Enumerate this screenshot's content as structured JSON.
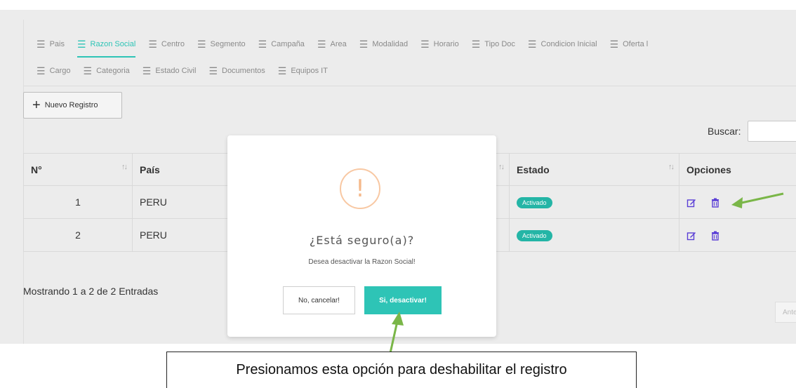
{
  "tabs_row1": [
    {
      "label": "Pais",
      "active": false
    },
    {
      "label": "Razon Social",
      "active": true
    },
    {
      "label": "Centro",
      "active": false
    },
    {
      "label": "Segmento",
      "active": false
    },
    {
      "label": "Campaña",
      "active": false
    },
    {
      "label": "Area",
      "active": false
    },
    {
      "label": "Modalidad",
      "active": false
    },
    {
      "label": "Horario",
      "active": false
    },
    {
      "label": "Tipo Doc",
      "active": false
    },
    {
      "label": "Condicion Inicial",
      "active": false
    },
    {
      "label": "Oferta l",
      "active": false
    }
  ],
  "tabs_row2": [
    {
      "label": "Cargo"
    },
    {
      "label": "Categoria"
    },
    {
      "label": "Estado Civil"
    },
    {
      "label": "Documentos"
    },
    {
      "label": "Equipos IT"
    }
  ],
  "toolbar": {
    "new_label": "Nuevo Registro"
  },
  "search": {
    "label": "Buscar:",
    "value": ""
  },
  "table": {
    "headers": {
      "num": "N°",
      "country": "País",
      "status": "Estado",
      "options": "Opciones"
    },
    "rows": [
      {
        "num": "1",
        "country": "PERU",
        "status": "Activado"
      },
      {
        "num": "2",
        "country": "PERU",
        "status": "Activado"
      }
    ]
  },
  "footer": {
    "showing": "Mostrando 1 a 2 de 2 Entradas",
    "prev": "Ante"
  },
  "modal": {
    "icon": "!",
    "title": "¿Está seguro(a)?",
    "text": "Desea desactivar la Razon Social!",
    "cancel": "No, cancelar!",
    "confirm": "Si, desactivar!"
  },
  "caption": "Presionamos esta opción para deshabilitar el registro",
  "colors": {
    "accent": "#2ec4b6",
    "badge": "#24b5a6",
    "warning": "#f5b98b",
    "icon": "#5b3fd6",
    "arrow": "#7ab648"
  }
}
